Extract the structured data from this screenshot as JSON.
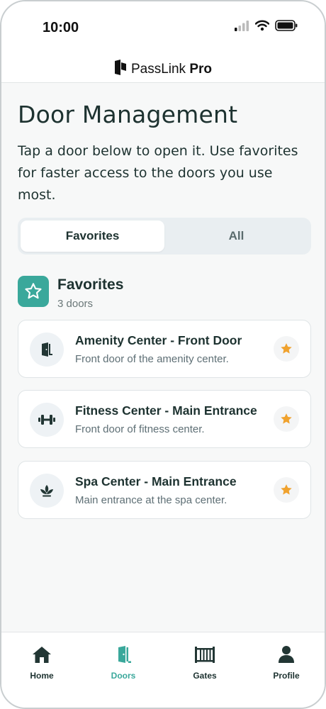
{
  "status_bar": {
    "time": "10:00"
  },
  "app": {
    "brand_regular": "PassLink",
    "brand_bold": "Pro"
  },
  "page": {
    "title": "Door Management",
    "description": "Tap a door below to open it. Use favorites for faster access to the doors you use most."
  },
  "segment": {
    "options": [
      "Favorites",
      "All"
    ],
    "selected": "Favorites"
  },
  "section": {
    "title": "Favorites",
    "count": "3 doors"
  },
  "doors": [
    {
      "name": "Amenity Center - Front Door",
      "description": "Front door of the amenity center.",
      "icon": "door-icon",
      "favorite": true
    },
    {
      "name": "Fitness Center - Main Entrance",
      "description": "Front door of fitness center.",
      "icon": "dumbbell-icon",
      "favorite": true
    },
    {
      "name": "Spa Center - Main Entrance",
      "description": "Main entrance at the spa center.",
      "icon": "lotus-icon",
      "favorite": true
    }
  ],
  "tabs": [
    {
      "label": "Home",
      "icon": "home-icon"
    },
    {
      "label": "Doors",
      "icon": "door-icon"
    },
    {
      "label": "Gates",
      "icon": "gate-icon"
    },
    {
      "label": "Profile",
      "icon": "person-icon"
    }
  ],
  "active_tab": "Doors",
  "colors": {
    "accent": "#3aa89b",
    "star": "#f0a22e",
    "text": "#1d3230"
  }
}
